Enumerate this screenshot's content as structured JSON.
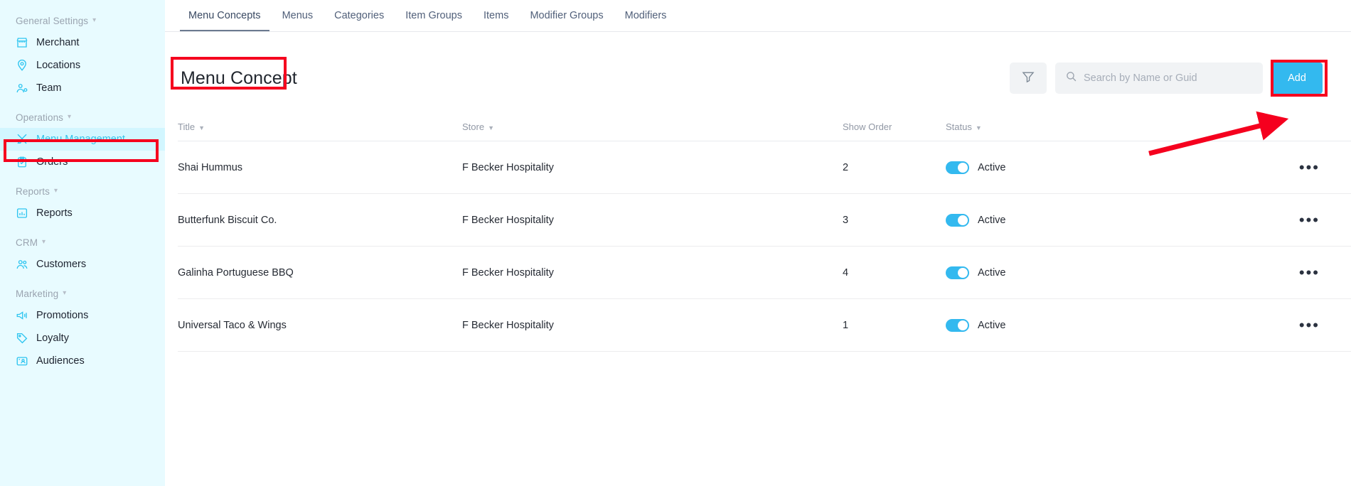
{
  "sidebar": {
    "groups": [
      {
        "label": "General Settings",
        "items": [
          {
            "label": "Merchant",
            "icon": "store-icon"
          },
          {
            "label": "Locations",
            "icon": "map-pin-icon"
          },
          {
            "label": "Team",
            "icon": "team-icon"
          }
        ]
      },
      {
        "label": "Operations",
        "items": [
          {
            "label": "Menu Management",
            "icon": "cutlery-icon",
            "active": true
          },
          {
            "label": "Orders",
            "icon": "clipboard-check-icon"
          }
        ]
      },
      {
        "label": "Reports",
        "items": [
          {
            "label": "Reports",
            "icon": "bar-chart-icon"
          }
        ]
      },
      {
        "label": "CRM",
        "items": [
          {
            "label": "Customers",
            "icon": "people-icon"
          }
        ]
      },
      {
        "label": "Marketing",
        "items": [
          {
            "label": "Promotions",
            "icon": "megaphone-icon"
          },
          {
            "label": "Loyalty",
            "icon": "tag-icon"
          },
          {
            "label": "Audiences",
            "icon": "audience-icon"
          }
        ]
      }
    ]
  },
  "tabs": [
    {
      "label": "Menu Concepts",
      "active": true
    },
    {
      "label": "Menus",
      "active": false
    },
    {
      "label": "Categories",
      "active": false
    },
    {
      "label": "Item Groups",
      "active": false
    },
    {
      "label": "Items",
      "active": false
    },
    {
      "label": "Modifier Groups",
      "active": false
    },
    {
      "label": "Modifiers",
      "active": false
    }
  ],
  "page": {
    "title": "Menu Concept"
  },
  "toolbar": {
    "filter_icon": "filter-icon",
    "search_icon": "search-icon",
    "search_value": "",
    "search_placeholder": "Search by Name or Guid",
    "add_label": "Add"
  },
  "table": {
    "columns": [
      {
        "label": "Title",
        "sortable": true
      },
      {
        "label": "Store",
        "sortable": true
      },
      {
        "label": "Show Order",
        "sortable": false
      },
      {
        "label": "Status",
        "sortable": true
      }
    ],
    "rows": [
      {
        "title": "Shai Hummus",
        "store": "F Becker Hospitality",
        "show_order": "2",
        "status": "Active",
        "status_on": true,
        "actions": "•••"
      },
      {
        "title": "Butterfunk Biscuit Co.",
        "store": "F Becker Hospitality",
        "show_order": "3",
        "status": "Active",
        "status_on": true,
        "actions": "•••"
      },
      {
        "title": "Galinha Portuguese BBQ",
        "store": "F Becker Hospitality",
        "show_order": "4",
        "status": "Active",
        "status_on": true,
        "actions": "•••"
      },
      {
        "title": "Universal Taco & Wings",
        "store": "F Becker Hospitality",
        "show_order": "1",
        "status": "Active",
        "status_on": true,
        "actions": "•••"
      }
    ]
  },
  "annotations": {
    "highlight_color": "#f5001e",
    "arrow_color": "#f5001e",
    "boxes": [
      "sidebar-menu-management",
      "page-title",
      "add-button"
    ]
  },
  "colors": {
    "accent": "#33b9ef",
    "sidebar_bg": "#e8fbff",
    "sidebar_active_bg": "#d2f6ff",
    "annotation_red": "#f5001e"
  }
}
